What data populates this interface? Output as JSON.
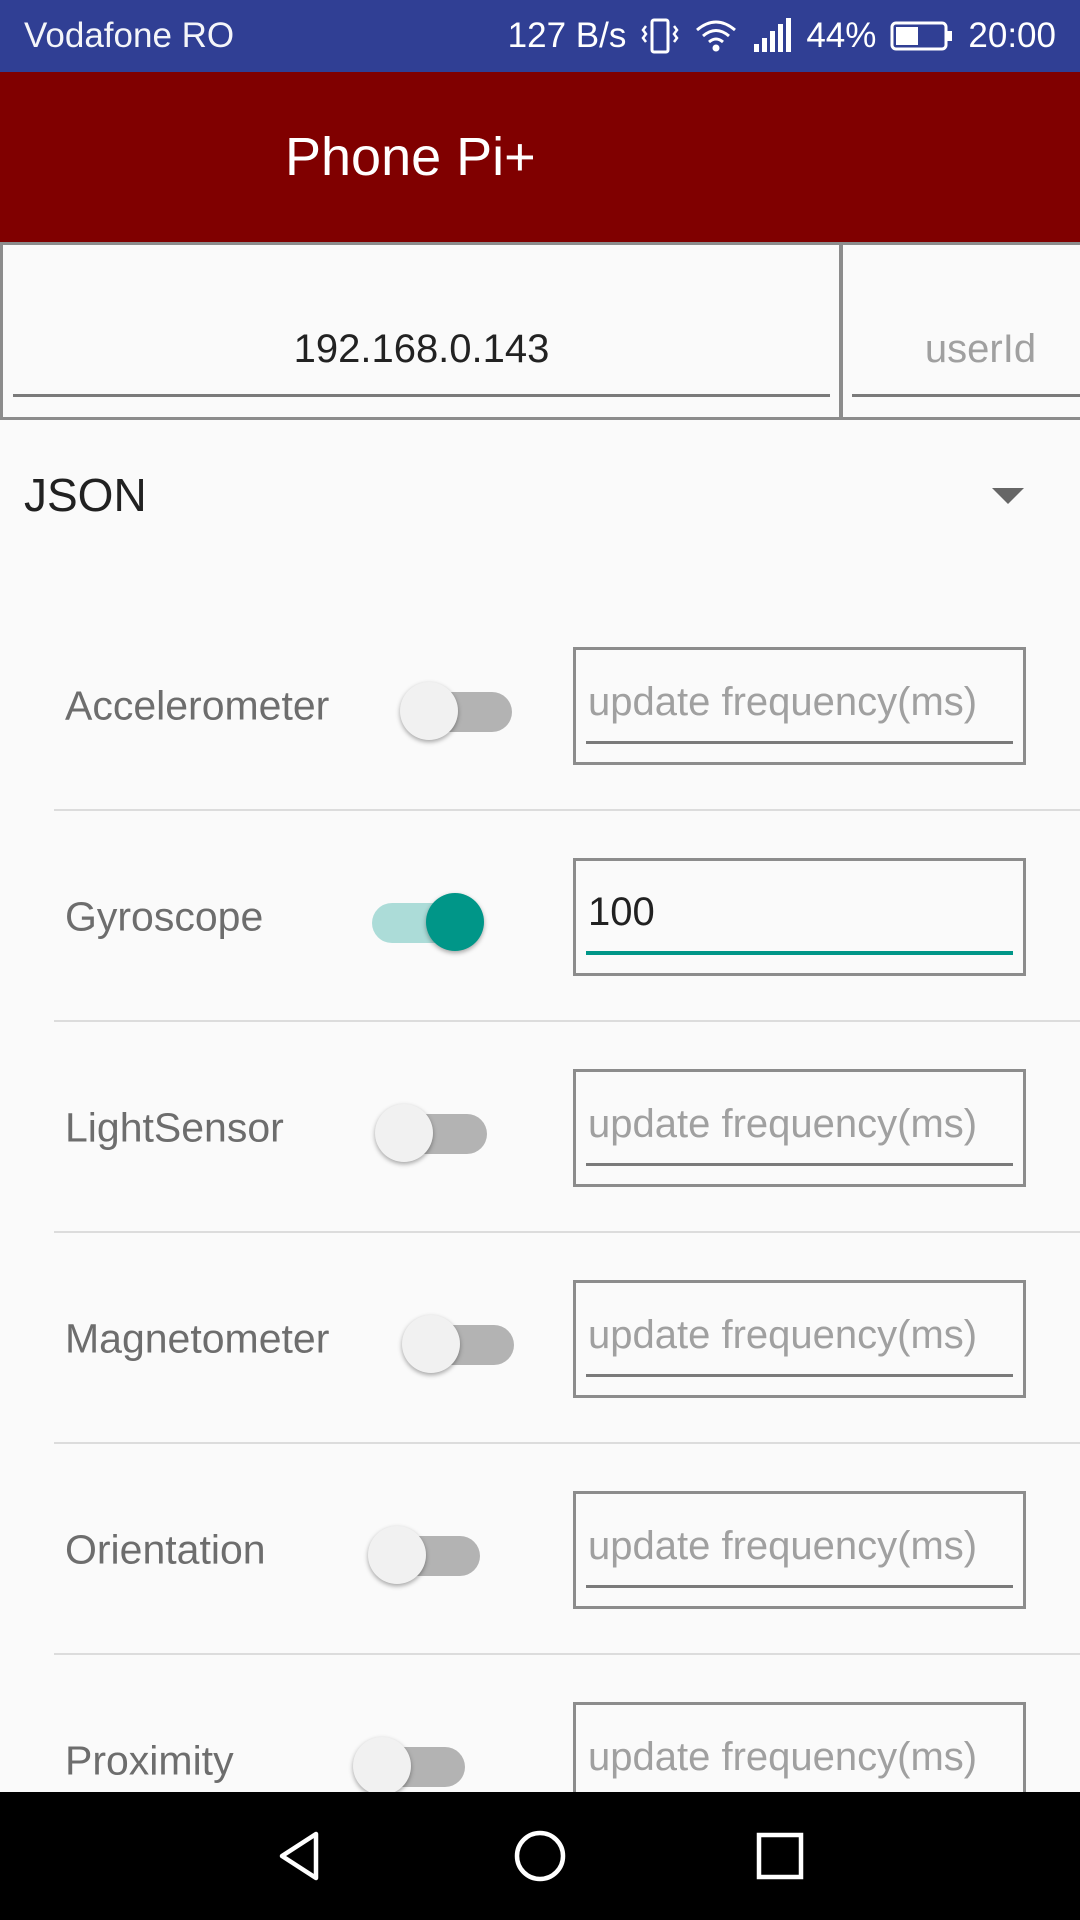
{
  "status_bar": {
    "carrier": "Vodafone RO",
    "net_speed": "127 B/s",
    "battery": "44%",
    "time": "20:00",
    "icons": [
      "vibrate-icon",
      "wifi-icon",
      "signal-icon",
      "battery-icon"
    ]
  },
  "app_bar": {
    "title": "Phone Pi+"
  },
  "connection": {
    "ip_value": "192.168.0.143",
    "ip_placeholder": "",
    "user_value": "",
    "user_placeholder": "userId"
  },
  "format": {
    "selected": "JSON"
  },
  "sensors": [
    {
      "label": "Accelerometer",
      "enabled": false,
      "frequency": "",
      "placeholder": "update frequency(ms)"
    },
    {
      "label": "Gyroscope",
      "enabled": true,
      "frequency": "100",
      "placeholder": "update frequency(ms)"
    },
    {
      "label": "LightSensor",
      "enabled": false,
      "frequency": "",
      "placeholder": "update frequency(ms)"
    },
    {
      "label": "Magnetometer",
      "enabled": false,
      "frequency": "",
      "placeholder": "update frequency(ms)"
    },
    {
      "label": "Orientation",
      "enabled": false,
      "frequency": "",
      "placeholder": "update frequency(ms)"
    },
    {
      "label": "Proximity",
      "enabled": false,
      "frequency": "",
      "placeholder": "update frequency(ms)"
    }
  ],
  "colors": {
    "status_bar": "#303f94",
    "app_bar": "#800000",
    "accent": "#009688",
    "nav_bar": "#000000"
  },
  "nav_bar": {
    "icons": [
      "back-icon",
      "home-icon",
      "recents-icon"
    ]
  }
}
